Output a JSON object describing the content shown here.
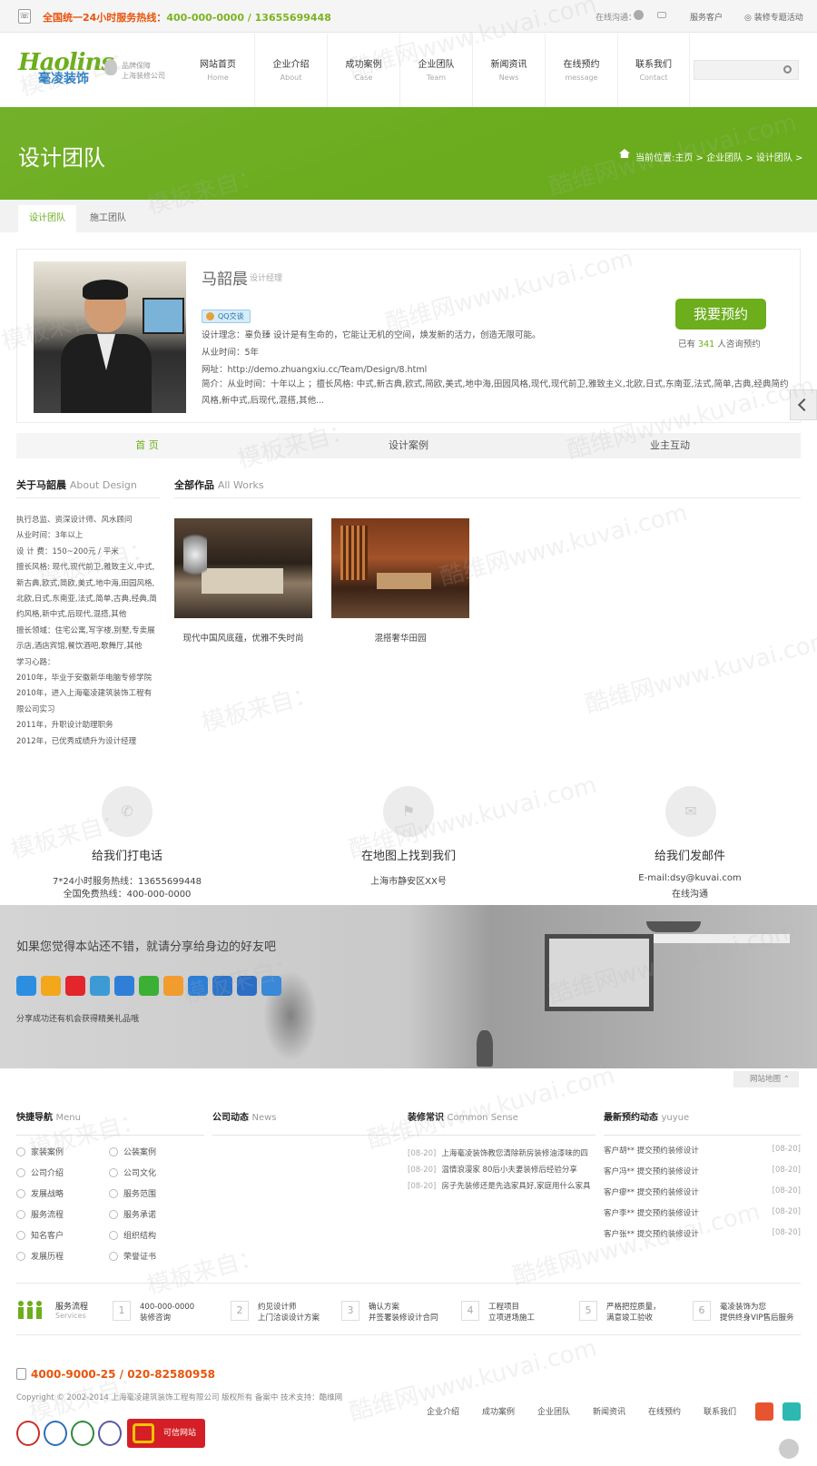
{
  "topbar": {
    "hotline_label": "全国统一24小时服务热线：",
    "hotline_numbers": "400-000-0000 / 13655699448",
    "online": "在线沟通：",
    "service": "服务客户",
    "special": "装修专题活动"
  },
  "header": {
    "logo_en": "Haolins",
    "logo_cn": "毫凌装饰",
    "badge_line1": "品牌保障",
    "badge_line2": "上海装修公司",
    "search_placeholder": "",
    "nav": [
      {
        "cn": "网站首页",
        "en": "Home"
      },
      {
        "cn": "企业介绍",
        "en": "About"
      },
      {
        "cn": "成功案例",
        "en": "Case"
      },
      {
        "cn": "企业团队",
        "en": "Team"
      },
      {
        "cn": "新闻资讯",
        "en": "News"
      },
      {
        "cn": "在线预约",
        "en": "message"
      },
      {
        "cn": "联系我们",
        "en": "Contact"
      }
    ]
  },
  "banner": {
    "title": "设计团队",
    "breadcrumb": "当前位置:主页 > 企业团队 > 设计团队 >"
  },
  "subtabs": [
    "设计团队",
    "施工团队"
  ],
  "profile": {
    "name": "马韶晨",
    "role": "设计经理",
    "qq": "QQ交谈",
    "idea": "设计理念：辜负臻 设计是有生命的，它能让无机的空间，焕发新的活力，创造无限可能。",
    "years": "从业时间：5年",
    "url": "网址：http://demo.zhuangxiu.cc/Team/Design/8.html",
    "intro": "简介：从业时间：十年以上 ；擅长风格: 中式,新古典,欧式,简欧,美式,地中海,田园风格,现代,现代前卫,雅致主义,北欧,日式,东南亚,法式,简单,古典,经典简约风格,新中式,后现代,混搭,其他...",
    "book_button": "我要预约",
    "booked_prefix": "已有",
    "booked_count": "341",
    "booked_suffix": "人咨询预约"
  },
  "detail_tabs": [
    "首 页",
    "设计案例",
    "业主互动"
  ],
  "about": {
    "title": "关于马韶晨",
    "title_en": "About Design",
    "lines": [
      "执行总监、资深设计师、风水顾问",
      "从业时间：3年以上",
      "设 计 费：150~200元 / 平米",
      "擅长风格: 现代,现代前卫,雅致主义,中式,",
      "新古典,欧式,简欧,美式,地中海,田园风格,",
      "北欧,日式,东南亚,法式,简单,古典,经典,简",
      "约风格,新中式,后现代,混搭,其他",
      "擅长领域：住宅公寓,写字楼,别墅,专卖展",
      "示店,酒店宾馆,餐饮酒吧,歌舞厅,其他",
      "学习心路：",
      "2010年，毕业于安徽新华电脑专修学院",
      "2010年，进入上海毫凌建筑装饰工程有",
      "限公司实习",
      "2011年，升职设计助理职务",
      "2012年，已优秀成绩升为设计经理"
    ]
  },
  "works": {
    "title": "全部作品",
    "title_en": "All Works",
    "items": [
      {
        "caption": "现代中国风底蕴，优雅不失时尚"
      },
      {
        "caption": "混搭奢华田园"
      }
    ]
  },
  "contact": [
    {
      "title": "给我们打电话",
      "lines": [
        "7*24小时服务热线：13655699448",
        "全国免费热线：400-000-0000"
      ]
    },
    {
      "title": "在地图上找到我们",
      "lines": [
        "上海市静安区XX号"
      ]
    },
    {
      "title": "给我们发邮件",
      "lines": [
        "E-mail:dsy@kuvai.com",
        "在线沟通"
      ]
    }
  ],
  "share": {
    "text": "如果您觉得本站还不错，就请分享给身边的好友吧",
    "sub": "分享成功还有机会获得精美礼品哦",
    "colors": [
      "#2c8ee0",
      "#f3a71b",
      "#e3262c",
      "#3c9bd4",
      "#2f7fd8",
      "#3cb034",
      "#f29b2e",
      "#2d7ed6",
      "#2d73c9",
      "#2b6ec6",
      "#3a88d8"
    ]
  },
  "sitemap": "网站地图",
  "footer_cols": {
    "quick": {
      "title": "快捷导航",
      "title_en": "Menu",
      "items": [
        "家装案例",
        "公装案例",
        "公司介绍",
        "公司文化",
        "发展战略",
        "服务范围",
        "服务流程",
        "服务承诺",
        "知名客户",
        "组织结构",
        "发展历程",
        "荣誉证书"
      ]
    },
    "company": {
      "title": "公司动态",
      "title_en": "News"
    },
    "sense": {
      "title": "装修常识",
      "title_en": "Common Sense",
      "items": [
        {
          "date": "[08-20]",
          "title": "上海毫凌装饰教您清除新房装修油漆味的四"
        },
        {
          "date": "[08-20]",
          "title": "温情浪漫家 80后小夫妻装修后经验分享"
        },
        {
          "date": "[08-20]",
          "title": "房子先装修还是先选家具好,家庭用什么家具"
        }
      ]
    },
    "booking": {
      "title": "最新预约动态",
      "title_en": "yuyue",
      "items": [
        {
          "text": "客户胡** 提交预约装修设计",
          "date": "[08-20]"
        },
        {
          "text": "客户冯** 提交预约装修设计",
          "date": "[08-20]"
        },
        {
          "text": "客户瘳** 提交预约装修设计",
          "date": "[08-20]"
        },
        {
          "text": "客户李** 提交预约装修设计",
          "date": "[08-20]"
        },
        {
          "text": "客户张** 提交预约装修设计",
          "date": "[08-20]"
        }
      ]
    }
  },
  "services": {
    "title": "服务流程",
    "title_en": "Services",
    "steps": [
      {
        "num": "1",
        "l1": "400-000-0000",
        "l2": "装修咨询"
      },
      {
        "num": "2",
        "l1": "约见设计师",
        "l2": "上门洽谈设计方案"
      },
      {
        "num": "3",
        "l1": "确认方案",
        "l2": "并签署装修设计合同"
      },
      {
        "num": "4",
        "l1": "工程项目",
        "l2": "立项进场施工"
      },
      {
        "num": "5",
        "l1": "严格把控质量，",
        "l2": "满意竣工验收"
      },
      {
        "num": "6",
        "l1": "毫凌装饰为您",
        "l2": "提供终身VIP售后服务"
      }
    ]
  },
  "footer": {
    "hotline": "4000-9000-25 / 020-82580958",
    "copyright": "Copyright © 2002-2014 上海毫凌建筑装饰工程有限公司 版权所有 备案中 技术支持：酷维网",
    "nav": [
      "企业介绍",
      "成功案例",
      "企业团队",
      "新闻资讯",
      "在线预约",
      "联系我们"
    ],
    "trust_label": "可信网站"
  },
  "watermark": [
    "模板来自：",
    "酷维网www.kuvai.com"
  ]
}
